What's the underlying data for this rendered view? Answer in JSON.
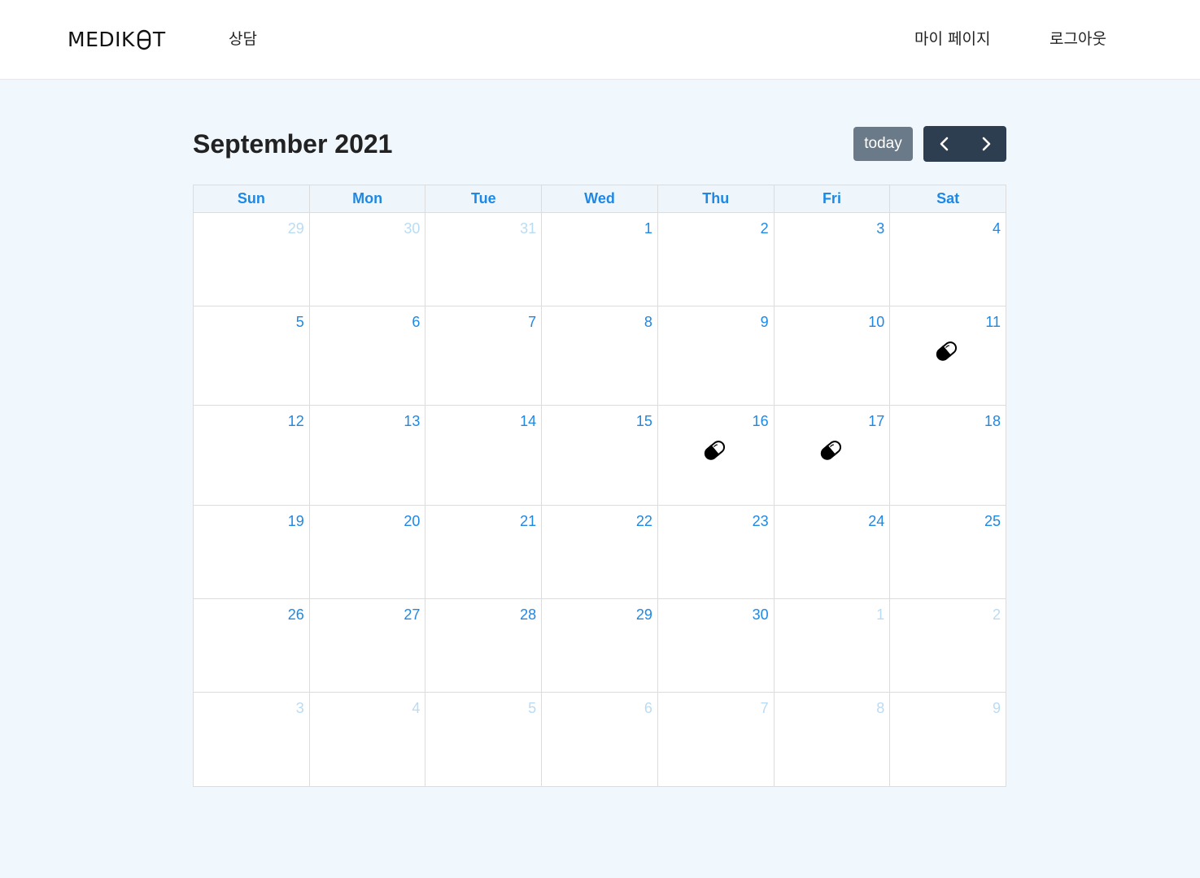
{
  "nav": {
    "logo_left": "MEDIK",
    "logo_right": "T",
    "consult": "상담",
    "mypage": "마이 페이지",
    "logout": "로그아웃"
  },
  "calendar": {
    "title": "September 2021",
    "today_label": "today",
    "prev_icon": "chevron-left-icon",
    "next_icon": "chevron-right-icon",
    "weekdays": [
      "Sun",
      "Mon",
      "Tue",
      "Wed",
      "Thu",
      "Fri",
      "Sat"
    ],
    "weeks": [
      [
        {
          "d": "29",
          "other": true
        },
        {
          "d": "30",
          "other": true
        },
        {
          "d": "31",
          "other": true
        },
        {
          "d": "1"
        },
        {
          "d": "2"
        },
        {
          "d": "3"
        },
        {
          "d": "4"
        }
      ],
      [
        {
          "d": "5"
        },
        {
          "d": "6"
        },
        {
          "d": "7"
        },
        {
          "d": "8"
        },
        {
          "d": "9"
        },
        {
          "d": "10"
        },
        {
          "d": "11",
          "pill": true
        }
      ],
      [
        {
          "d": "12"
        },
        {
          "d": "13"
        },
        {
          "d": "14"
        },
        {
          "d": "15"
        },
        {
          "d": "16",
          "pill": true
        },
        {
          "d": "17",
          "pill": true
        },
        {
          "d": "18"
        }
      ],
      [
        {
          "d": "19"
        },
        {
          "d": "20"
        },
        {
          "d": "21"
        },
        {
          "d": "22"
        },
        {
          "d": "23"
        },
        {
          "d": "24"
        },
        {
          "d": "25"
        }
      ],
      [
        {
          "d": "26"
        },
        {
          "d": "27"
        },
        {
          "d": "28"
        },
        {
          "d": "29"
        },
        {
          "d": "30"
        },
        {
          "d": "1",
          "other": true
        },
        {
          "d": "2",
          "other": true
        }
      ],
      [
        {
          "d": "3",
          "other": true
        },
        {
          "d": "4",
          "other": true
        },
        {
          "d": "5",
          "other": true
        },
        {
          "d": "6",
          "other": true
        },
        {
          "d": "7",
          "other": true
        },
        {
          "d": "8",
          "other": true
        },
        {
          "d": "9",
          "other": true
        }
      ]
    ],
    "colors": {
      "day_number": "#1e88e5",
      "other_month": "#b9dcf5",
      "nav_buttons": "#2c3e50",
      "today_button": "#6b7a89"
    },
    "event_icon": "pill-icon"
  }
}
